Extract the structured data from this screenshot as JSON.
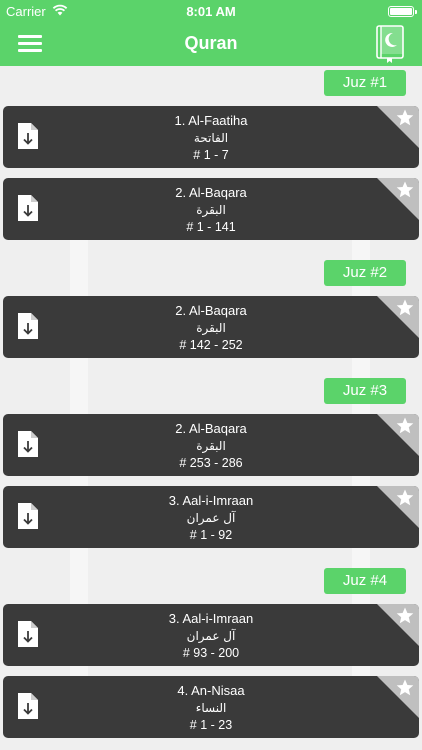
{
  "status_bar": {
    "carrier": "Carrier",
    "time": "8:01 AM"
  },
  "nav": {
    "title": "Quran",
    "menu_icon": "hamburger-icon",
    "right_icon": "quran-book-icon"
  },
  "colors": {
    "accent": "#5bd36a",
    "card": "#3a3a3a",
    "corner": "#bfbfbf"
  },
  "sections": [
    {
      "label": "Juz #1",
      "items": [
        {
          "title": "1. Al-Faatiha",
          "arabic": "الفاتحة",
          "range": "# 1 - 7"
        },
        {
          "title": "2. Al-Baqara",
          "arabic": "البقرة",
          "range": "# 1 - 141"
        }
      ]
    },
    {
      "label": "Juz #2",
      "items": [
        {
          "title": "2. Al-Baqara",
          "arabic": "البقرة",
          "range": "# 142 - 252"
        }
      ]
    },
    {
      "label": "Juz #3",
      "items": [
        {
          "title": "2. Al-Baqara",
          "arabic": "البقرة",
          "range": "# 253 - 286"
        },
        {
          "title": "3. Aal-i-Imraan",
          "arabic": "آل عمران",
          "range": "# 1 - 92"
        }
      ]
    },
    {
      "label": "Juz #4",
      "items": [
        {
          "title": "3. Aal-i-Imraan",
          "arabic": "آل عمران",
          "range": "# 93 - 200"
        },
        {
          "title": "4. An-Nisaa",
          "arabic": "النساء",
          "range": "# 1 - 23"
        }
      ]
    }
  ]
}
